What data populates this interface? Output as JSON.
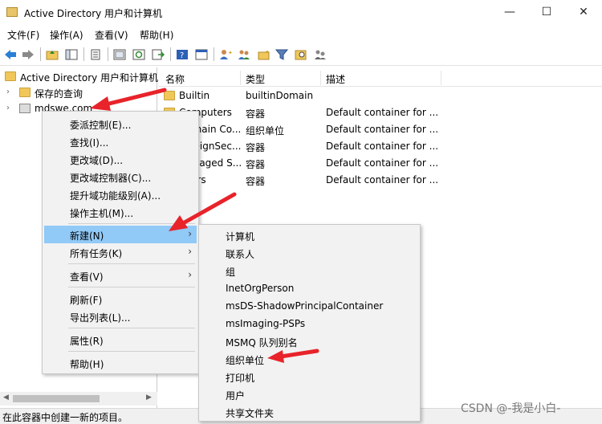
{
  "window": {
    "title": "Active Directory 用户和计算机",
    "controls": {
      "minimize": "—",
      "maximize": "☐",
      "close": "✕"
    }
  },
  "menubar": [
    {
      "label": "文件(F)"
    },
    {
      "label": "操作(A)"
    },
    {
      "label": "查看(V)"
    },
    {
      "label": "帮助(H)"
    }
  ],
  "toolbar": {
    "icons": [
      "back-icon",
      "forward-icon",
      "up-folder-icon",
      "show-tree-icon",
      "properties-icon",
      "refresh-icon",
      "export-list-icon",
      "help-icon",
      "console-icon",
      "new-user-icon",
      "new-group-icon",
      "new-ou-icon",
      "filter-icon",
      "find-icon",
      "delegate-icon"
    ]
  },
  "tree": {
    "items": [
      {
        "label": "Active Directory 用户和计算机",
        "icon": "aduc-icon"
      },
      {
        "label": "保存的查询",
        "icon": "folder-icon"
      },
      {
        "label": "mdswe.com",
        "icon": "domain-icon"
      }
    ]
  },
  "list": {
    "columns": [
      "名称",
      "类型",
      "描述"
    ],
    "rows": [
      {
        "name": "Builtin",
        "type": "builtinDomain",
        "desc": ""
      },
      {
        "name": "Computers",
        "type": "容器",
        "desc": "Default container for ..."
      },
      {
        "name": "Domain Co...",
        "type": "组织单位",
        "desc": "Default container for ..."
      },
      {
        "name": "ForeignSec...",
        "type": "容器",
        "desc": "Default container for ..."
      },
      {
        "name": "Managed S...",
        "type": "容器",
        "desc": "Default container for ..."
      },
      {
        "name": "Users",
        "type": "容器",
        "desc": "Default container for ..."
      }
    ]
  },
  "context_menu": {
    "items": [
      {
        "label": "委派控制(E)..."
      },
      {
        "label": "查找(I)..."
      },
      {
        "label": "更改域(D)..."
      },
      {
        "label": "更改域控制器(C)..."
      },
      {
        "label": "提升域功能级别(A)..."
      },
      {
        "label": "操作主机(M)..."
      },
      {
        "label": "新建(N)",
        "submenu": true,
        "active": true
      },
      {
        "label": "所有任务(K)",
        "submenu": true
      },
      {
        "label": "查看(V)",
        "submenu": true
      },
      {
        "label": "刷新(F)"
      },
      {
        "label": "导出列表(L)..."
      },
      {
        "label": "属性(R)"
      },
      {
        "label": "帮助(H)"
      }
    ],
    "submenu_arrow": "›"
  },
  "submenu": {
    "items": [
      {
        "label": "计算机"
      },
      {
        "label": "联系人"
      },
      {
        "label": "组"
      },
      {
        "label": "InetOrgPerson"
      },
      {
        "label": "msDS-ShadowPrincipalContainer"
      },
      {
        "label": "msImaging-PSPs"
      },
      {
        "label": "MSMQ 队列别名"
      },
      {
        "label": "组织单位"
      },
      {
        "label": "打印机"
      },
      {
        "label": "用户"
      },
      {
        "label": "共享文件夹"
      }
    ]
  },
  "statusbar": {
    "text": "在此容器中创建一新的项目。"
  },
  "watermark": "CSDN @-我是小白-",
  "colors": {
    "menu_highlight": "#91c9f7",
    "arrow_red": "#e8232a",
    "folder": "#f1c75a"
  }
}
